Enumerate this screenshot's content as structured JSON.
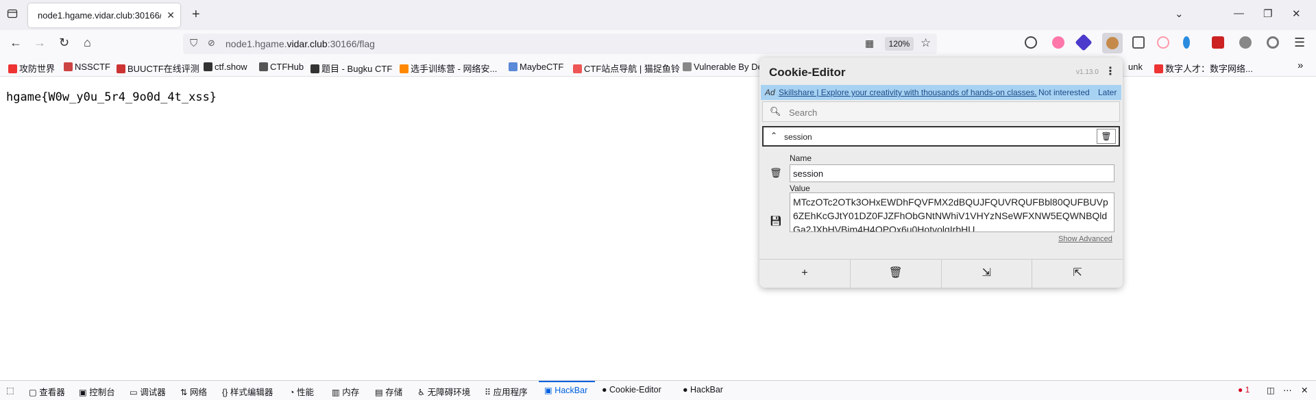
{
  "tab": {
    "title": "node1.hgame.vidar.club:30166/fl",
    "close": "✕"
  },
  "new_tab": "+",
  "window_controls": [
    "⌄",
    "—",
    "❐",
    "✕"
  ],
  "urlbar": {
    "prefix": "node1.hgame.",
    "domain": "vidar.club",
    "suffix": ":30166/flag",
    "zoom": "120%"
  },
  "bookmarks": [
    {
      "label": "攻防世界",
      "color": "#e33"
    },
    {
      "label": "NSSCTF",
      "color": "#c44"
    },
    {
      "label": "BUUCTF在线评测",
      "color": "#c33"
    },
    {
      "label": "ctf.show",
      "color": "#333"
    },
    {
      "label": "CTFHub",
      "color": "#555"
    },
    {
      "label": "题目 - Bugku CTF",
      "color": "#333"
    },
    {
      "label": "选手训练营 - 网络安...",
      "color": "#f80"
    },
    {
      "label": "MaybeCTF",
      "color": "#5a8ad8"
    },
    {
      "label": "CTF站点导航 | 猫捉鱼铃",
      "color": "#e55"
    },
    {
      "label": "Vulnerable By De",
      "color": "#888"
    },
    {
      "label": "unk",
      "color": ""
    },
    {
      "label": "数字人才：数字网络...",
      "color": "#e33"
    }
  ],
  "page": {
    "flag": "hgame{W0w_y0u_5r4_9o0d_4t_xss}"
  },
  "cookie_editor": {
    "title": "Cookie-Editor",
    "version": "v1.13.0",
    "ad": {
      "tag": "Ad",
      "link": "Skillshare | Explore your creativity with thousands of hands-on classes.",
      "not_interested": "Not interested",
      "later": "Later"
    },
    "search_placeholder": "Search",
    "cookie": {
      "header": "session",
      "name_label": "Name",
      "name_value": "session",
      "value_label": "Value",
      "value": "MTczOTc2OTk3OHxEWDhFQVFMX2dBQUJFQUVRQUFBbl80QUFBUVp6ZEhKcGJtY01DZ0FJZFhObGNtNWhiV1VHYzNSeWFXNW5EQWNBQldGa2JXbHVBim4H4OPOx6u0HotvolgIrbHU"
    },
    "show_advanced": "Show Advanced"
  },
  "devtools": {
    "tabs": [
      "查看器",
      "控制台",
      "调试器",
      "网络",
      "样式编辑器",
      "性能",
      "内存",
      "存储",
      "无障碍环境",
      "应用程序",
      "HackBar",
      "Cookie-Editor",
      "HackBar"
    ],
    "errors": "1",
    "active_color": "#0061e0"
  }
}
